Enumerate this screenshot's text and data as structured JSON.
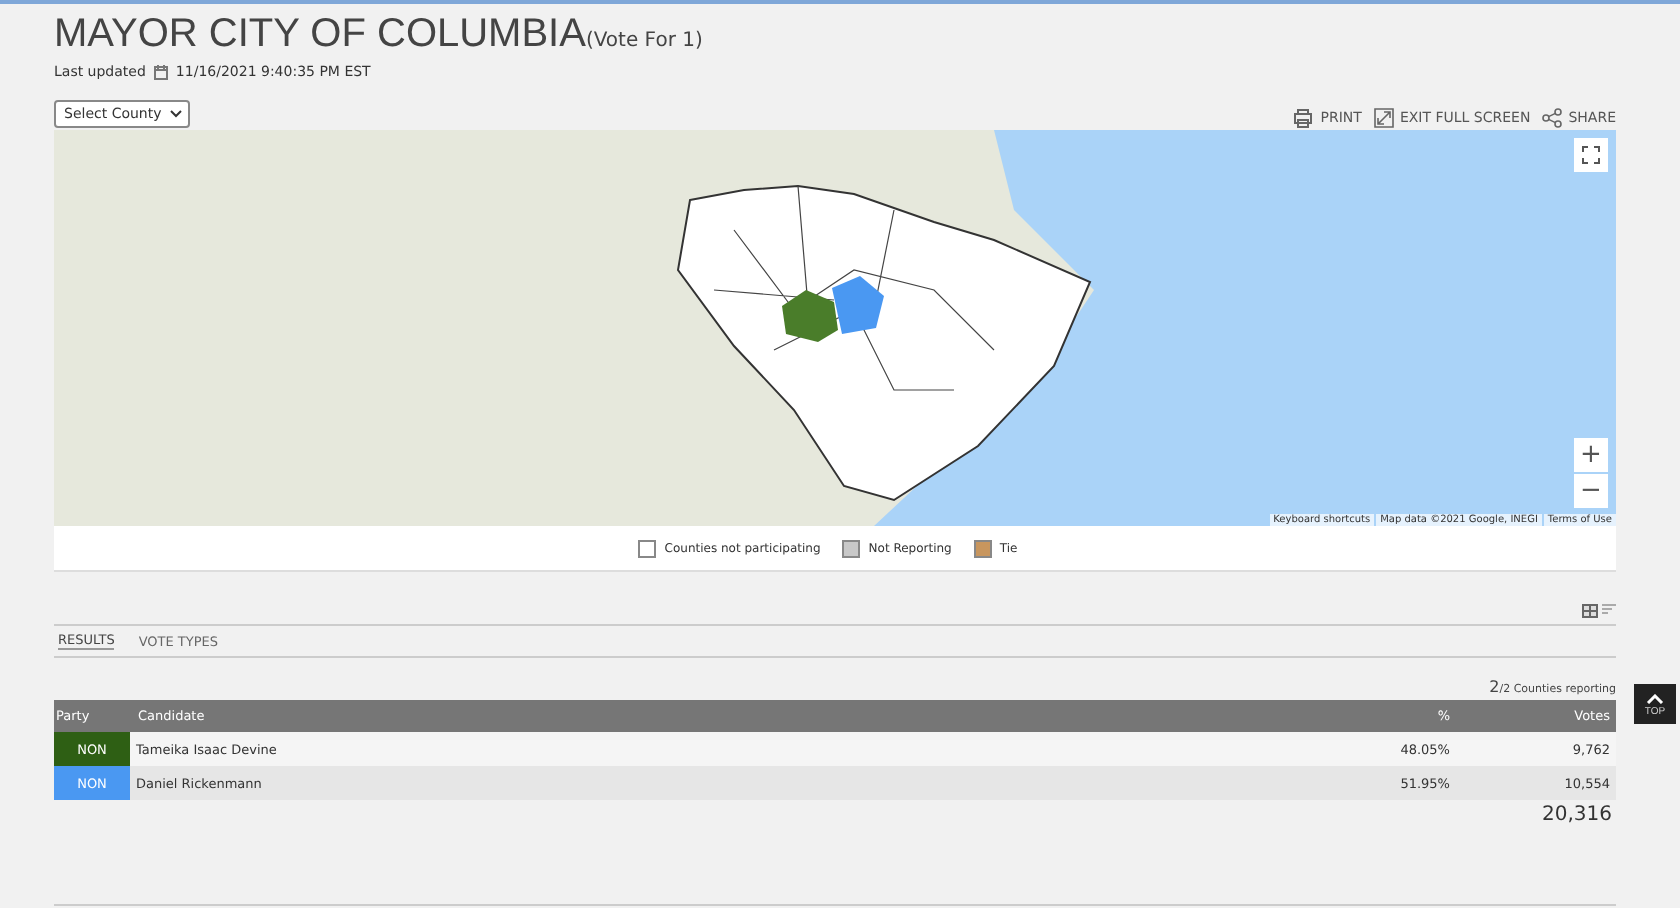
{
  "title": "MAYOR CITY OF COLUMBIA",
  "subtitle": "(Vote For 1)",
  "last_updated_label": "Last updated",
  "last_updated": "11/16/2021 9:40:35 PM EST",
  "county_select": "Select County",
  "actions": [
    {
      "kind": "print",
      "label": "PRINT"
    },
    {
      "kind": "exit",
      "label": "EXIT FULL SCREEN"
    },
    {
      "kind": "share",
      "label": "SHARE"
    }
  ],
  "map": {
    "attribution": [
      "Keyboard shortcuts",
      "Map data ©2021 Google, INEGI",
      "Terms of Use"
    ],
    "zoom_in": "+",
    "zoom_out": "−"
  },
  "legend": [
    {
      "label": "Counties not participating",
      "color": "#ffffff"
    },
    {
      "label": "Not Reporting",
      "color": "#c8c8c8"
    },
    {
      "label": "Tie",
      "color": "#c8965e"
    }
  ],
  "tabs": [
    {
      "label": "RESULTS",
      "selected": true
    },
    {
      "label": "VOTE TYPES",
      "selected": false
    }
  ],
  "reporting": {
    "count": "2",
    "total": "/2 Counties reporting"
  },
  "table": {
    "columns": [
      "Party",
      "Candidate",
      "%",
      "Votes"
    ],
    "rows": [
      {
        "party": "NON",
        "color": "#2e5f14",
        "candidate": "Tameika Isaac Devine",
        "percent": "48.05%",
        "votes": "9,762"
      },
      {
        "party": "NON",
        "color": "#4a98f2",
        "candidate": "Daniel Rickenmann",
        "percent": "51.95%",
        "votes": "10,554"
      }
    ]
  },
  "total": "20,316",
  "top_button": "TOP"
}
